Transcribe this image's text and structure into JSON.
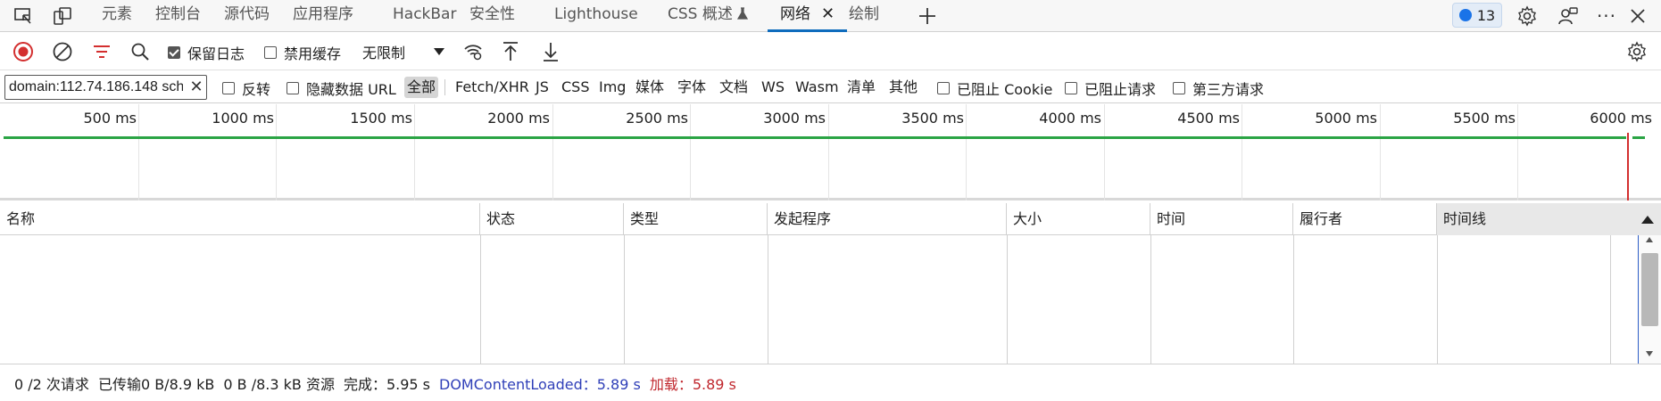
{
  "tabs": [
    {
      "label": "元素"
    },
    {
      "label": "控制台"
    },
    {
      "label": "源代码"
    },
    {
      "label": "应用程序"
    },
    {
      "label": "HackBar"
    },
    {
      "label": "安全性"
    },
    {
      "label": "Lighthouse"
    },
    {
      "label": "CSS 概述"
    },
    {
      "label": "网络",
      "active": true
    },
    {
      "label": "绘制"
    }
  ],
  "issues_count": "13",
  "toolbar": {
    "preserve_log_label": "保留日志",
    "preserve_log_checked": true,
    "disable_cache_label": "禁用缓存",
    "disable_cache_checked": false,
    "throttle_value": "无限制"
  },
  "filter": {
    "value": "domain:112.74.186.148 sch",
    "invert_label": "反转",
    "hide_data_urls_label": "隐藏数据 URL",
    "types": [
      "全部",
      "Fetch/XHR",
      "JS",
      "CSS",
      "Img",
      "媒体",
      "字体",
      "文档",
      "WS",
      "Wasm",
      "清单",
      "其他"
    ],
    "active_type": "全部",
    "blocked_cookies_label": "已阻止 Cookie",
    "blocked_requests_label": "已阻止请求",
    "third_party_label": "第三方请求"
  },
  "overview": {
    "tick_labels": [
      "500 ms",
      "1000 ms",
      "1500 ms",
      "2000 ms",
      "2500 ms",
      "3000 ms",
      "3500 ms",
      "4000 ms",
      "4500 ms",
      "5000 ms",
      "5500 ms",
      "6000 ms"
    ]
  },
  "table": {
    "columns": [
      "名称",
      "状态",
      "类型",
      "发起程序",
      "大小",
      "时间",
      "履行者",
      "时间线"
    ],
    "sorted_column": "时间线",
    "rows": []
  },
  "status": {
    "requests": "0 /2 次请求",
    "transferred": "已传输0 B/8.9 kB",
    "resources": "0 B /8.3 kB 资源",
    "finish": "完成：5.95 s",
    "dom_content_loaded": "DOMContentLoaded：5.89 s",
    "load": "加载：5.89 s"
  },
  "colors": {
    "accent": "#0f6cbd",
    "dom_content_loaded": "#2f3fb8",
    "load": "#c0272d",
    "overview_bar": "#2aa444"
  }
}
